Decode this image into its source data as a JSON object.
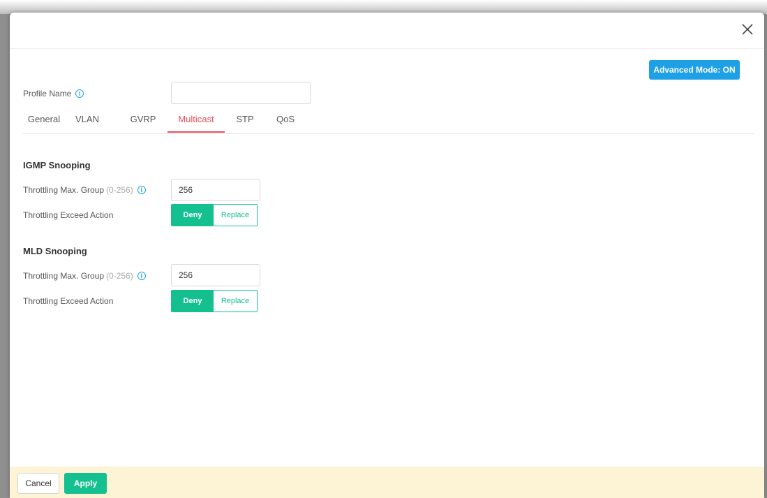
{
  "header": {
    "close_icon": "close-icon",
    "advanced_mode_label": "Advanced Mode: ON"
  },
  "profile": {
    "label": "Profile Name",
    "info_icon": "info-icon",
    "value": "",
    "placeholder": ""
  },
  "tabs": [
    {
      "label": "General",
      "active": false
    },
    {
      "label": "VLAN",
      "active": false
    },
    {
      "label": "GVRP",
      "active": false
    },
    {
      "label": "Multicast",
      "active": true
    },
    {
      "label": "STP",
      "active": false
    },
    {
      "label": "QoS",
      "active": false
    }
  ],
  "igmp": {
    "title": "IGMP Snooping",
    "max_group_label": "Throttling Max. Group",
    "max_group_range": "(0-256)",
    "max_group_value": "256",
    "exceed_action_label": "Throttling Exceed Action",
    "options": [
      "Deny",
      "Replace"
    ],
    "selected": "Deny"
  },
  "mld": {
    "title": "MLD Snooping",
    "max_group_label": "Throttling Max. Group",
    "max_group_range": "(0-256)",
    "max_group_value": "256",
    "exceed_action_label": "Throttling Exceed Action",
    "options": [
      "Deny",
      "Replace"
    ],
    "selected": "Deny"
  },
  "footer": {
    "cancel_label": "Cancel",
    "apply_label": "Apply"
  },
  "colors": {
    "accent_green": "#14c08f",
    "advanced_blue": "#1ea0e6",
    "active_tab_red": "#e8505b",
    "footer_bg": "#fdf4d6"
  }
}
